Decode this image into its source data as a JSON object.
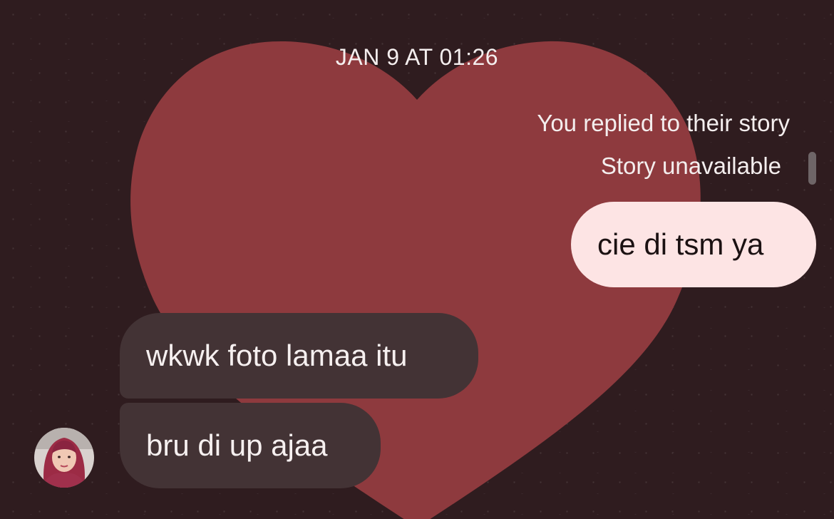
{
  "conversation": {
    "timestamp": "JAN 9 AT 01:26",
    "reply_note": "You replied to their story",
    "story_status": "Story unavailable"
  },
  "messages": [
    {
      "direction": "sent",
      "text": "cie di tsm ya"
    },
    {
      "direction": "received",
      "text": "wkwk foto lamaa itu"
    },
    {
      "direction": "received",
      "text": "bru di up ajaa"
    }
  ],
  "theme": {
    "background": "#2f1c1f",
    "heart_color": "#8e3a3e",
    "sent_bubble": "#fde4e4",
    "received_bubble": "#433335",
    "text_light": "#f4eeee"
  },
  "icons": {
    "avatar": "contact-avatar-photo"
  }
}
